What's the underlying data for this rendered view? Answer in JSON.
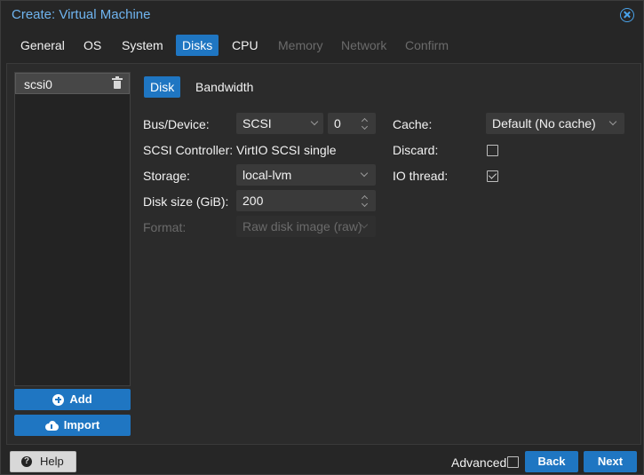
{
  "window": {
    "title": "Create: Virtual Machine"
  },
  "tabs": [
    {
      "label": "General",
      "state": "normal"
    },
    {
      "label": "OS",
      "state": "normal"
    },
    {
      "label": "System",
      "state": "normal"
    },
    {
      "label": "Disks",
      "state": "active"
    },
    {
      "label": "CPU",
      "state": "normal"
    },
    {
      "label": "Memory",
      "state": "disabled"
    },
    {
      "label": "Network",
      "state": "disabled"
    },
    {
      "label": "Confirm",
      "state": "disabled"
    }
  ],
  "disk_list": {
    "items": [
      {
        "label": "scsi0",
        "selected": true
      }
    ],
    "add_label": "Add",
    "import_label": "Import"
  },
  "subtabs": [
    {
      "label": "Disk",
      "state": "active"
    },
    {
      "label": "Bandwidth",
      "state": "normal"
    }
  ],
  "form": {
    "bus_device": {
      "label": "Bus/Device:",
      "bus": "SCSI",
      "device": "0"
    },
    "scsi_controller": {
      "label": "SCSI Controller:",
      "value": "VirtIO SCSI single"
    },
    "storage": {
      "label": "Storage:",
      "value": "local-lvm"
    },
    "disk_size": {
      "label": "Disk size (GiB):",
      "value": "200"
    },
    "format": {
      "label": "Format:",
      "value": "Raw disk image (raw)",
      "disabled": true
    },
    "cache": {
      "label": "Cache:",
      "value": "Default (No cache)"
    },
    "discard": {
      "label": "Discard:",
      "checked": false
    },
    "io_thread": {
      "label": "IO thread:",
      "checked": true
    }
  },
  "footer": {
    "help_label": "Help",
    "advanced_label": "Advanced",
    "advanced_checked": false,
    "back_label": "Back",
    "next_label": "Next"
  },
  "colors": {
    "accent": "#1f76c2",
    "title": "#6fb4ef",
    "background": "#262626"
  }
}
